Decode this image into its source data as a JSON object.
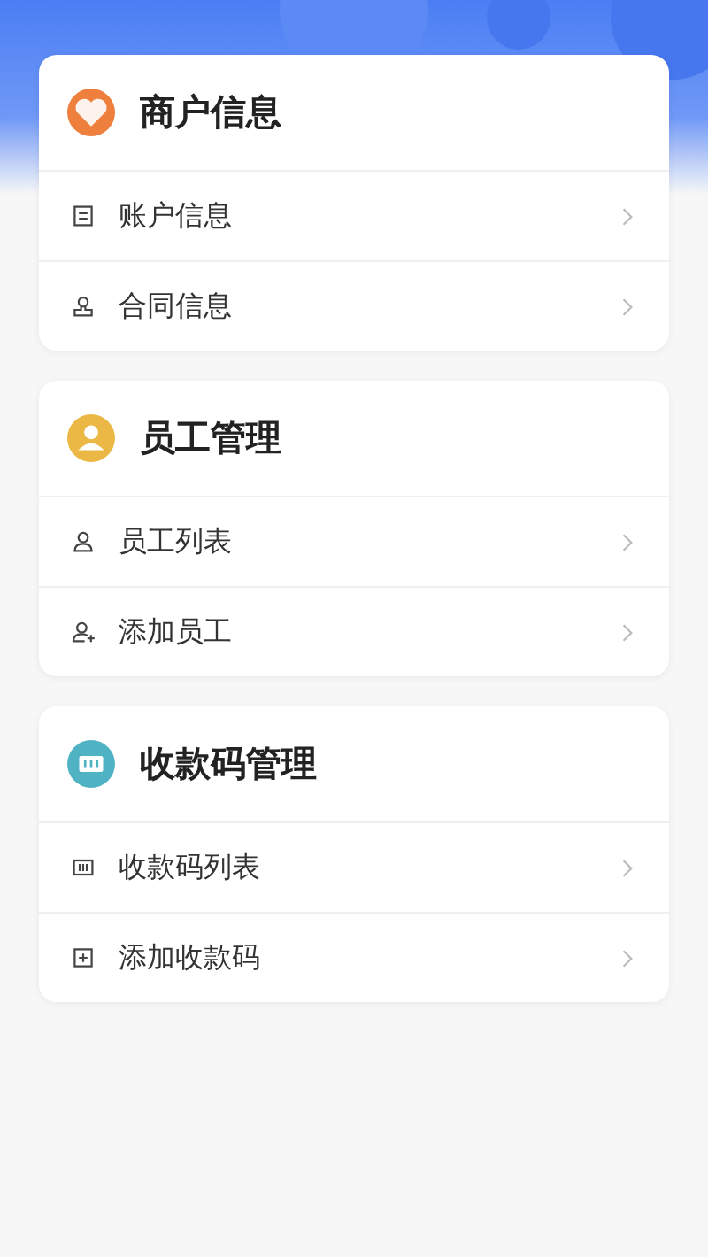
{
  "sections": [
    {
      "title": "商户信息",
      "kind": "heart",
      "color": "#ee7f3c",
      "items": [
        {
          "label": "账户信息",
          "kind": "list"
        },
        {
          "label": "合同信息",
          "kind": "stamp"
        }
      ]
    },
    {
      "title": "员工管理",
      "kind": "person",
      "color": "#ebb846",
      "items": [
        {
          "label": "员工列表",
          "kind": "person"
        },
        {
          "label": "添加员工",
          "kind": "person-add"
        }
      ]
    },
    {
      "title": "收款码管理",
      "kind": "barcode",
      "color": "#4fb3c4",
      "items": [
        {
          "label": "收款码列表",
          "kind": "barcode"
        },
        {
          "label": "添加收款码",
          "kind": "plus-box"
        }
      ]
    }
  ]
}
